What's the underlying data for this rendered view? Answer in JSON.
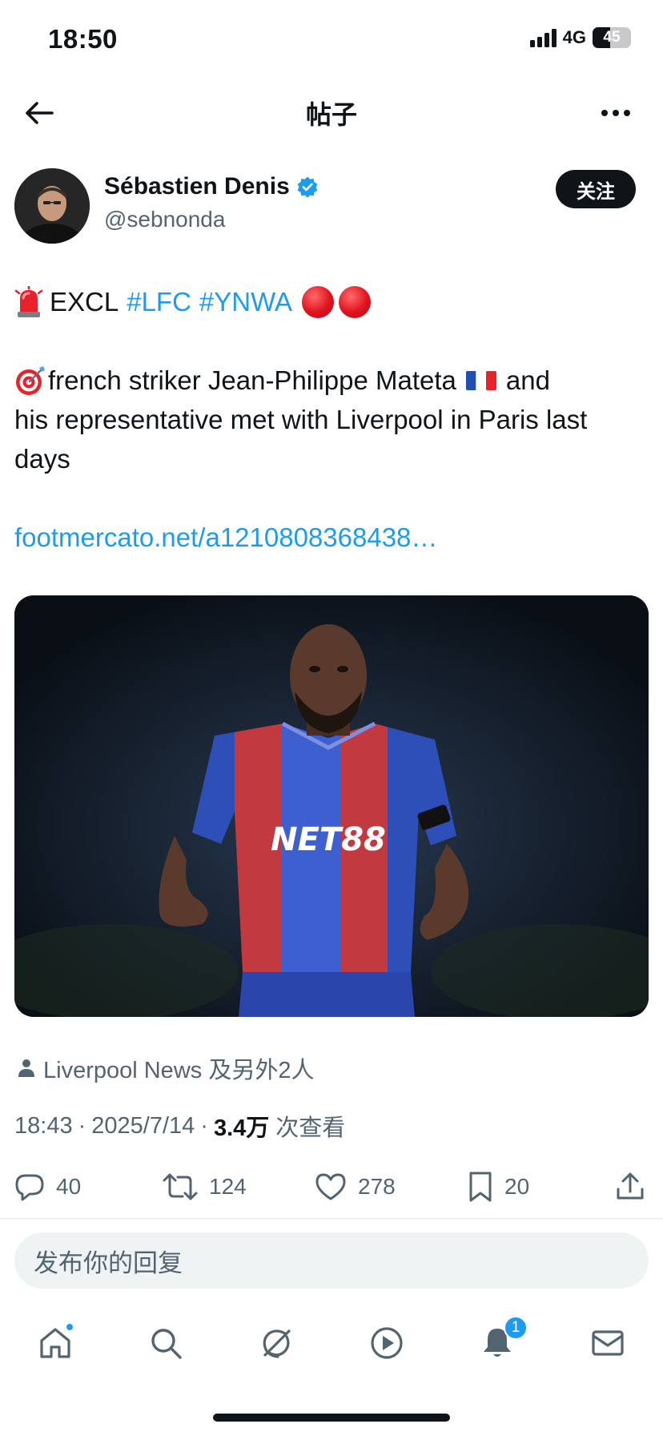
{
  "status_bar": {
    "time": "18:50",
    "network": "4G",
    "battery_level": "45",
    "battery_fraction": 0.45,
    "signal_bars": 4
  },
  "header": {
    "title": "帖子",
    "back_icon": "arrow-left-icon",
    "more_icon": "more-horizontal-icon"
  },
  "author": {
    "display_name": "Sébastien Denis",
    "handle": "@sebnonda",
    "verified": true,
    "follow_label": "关注"
  },
  "tweet": {
    "line1": {
      "emoji": "police-light-emoji",
      "text": "EXCL",
      "hashtags": [
        "#LFC",
        "#YNWA"
      ],
      "trailing_emojis": [
        "red-circle-emoji",
        "red-circle-emoji"
      ]
    },
    "para2": {
      "emoji": "bullseye-emoji",
      "line1_text": "french striker Jean-Philippe Mateta",
      "flag": "france-flag-emoji",
      "line1_tail": "and",
      "line2": "his representative met with Liverpool in Paris last",
      "line3": "days"
    },
    "link": "footmercato.net/a1210808368438…"
  },
  "media": {
    "description_icon": "player-photo",
    "shirt_sponsor": "NET88"
  },
  "context": {
    "text": "Liverpool News 及另外2人",
    "icon": "person-icon"
  },
  "meta": {
    "time": "18:43",
    "sep1": "·",
    "date": "2025/7/14",
    "sep2": "·",
    "views": "3.4万",
    "views_label": "次查看"
  },
  "actions": {
    "replies": "40",
    "reposts": "124",
    "likes": "278",
    "bookmarks": "20"
  },
  "reply_placeholder": "发布你的回复",
  "tabbar": {
    "notifications_count": "1"
  },
  "colors": {
    "accent": "#1d9bf0",
    "text": "#0f1419",
    "muted": "#536471",
    "follow_bg": "#0f1419"
  }
}
